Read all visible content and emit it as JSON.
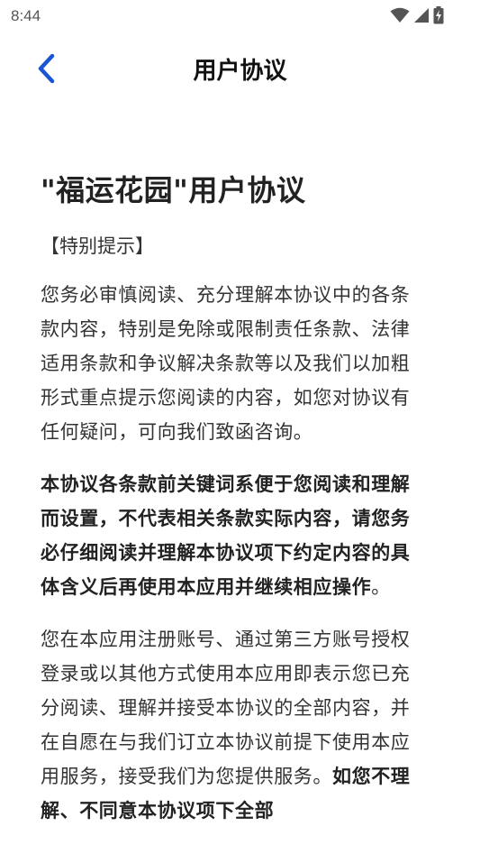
{
  "status_bar": {
    "time": "8:44",
    "icons": [
      "wifi-icon",
      "signal-icon",
      "battery-charging-icon"
    ]
  },
  "app_bar": {
    "title": "用户协议",
    "back_icon": "chevron-left-icon",
    "accent": "#1a55d6"
  },
  "document": {
    "title": "\"福运花园\"用户协议",
    "notice": "【特别提示】",
    "para1": "您务必审慎阅读、充分理解本协议中的各条款内容，特别是免除或限制责任条款、法律适用条款和争议解决条款等以及我们以加粗形式重点提示您阅读的内容，如您对协议有任何疑问，可向我们致函咨询。",
    "para2_bold": "本协议各条款前关键词系便于您阅读和理解而设置，不代表相关条款实际内容，请您务必仔细阅读并理解本协议项下约定内容的具体含义后再使用本应用并继续相应操作",
    "para2_end": "。",
    "para3_normal": "您在本应用注册账号、通过第三方账号授权登录或以其他方式使用本应用即表示您已充分阅读、理解并接受本协议的全部内容，并在自愿在与我们订立本协议前提下使用本应用服务，接受我们为您提供服务。",
    "para3_bold": "如您不理解、不同意本协议项下全部"
  }
}
